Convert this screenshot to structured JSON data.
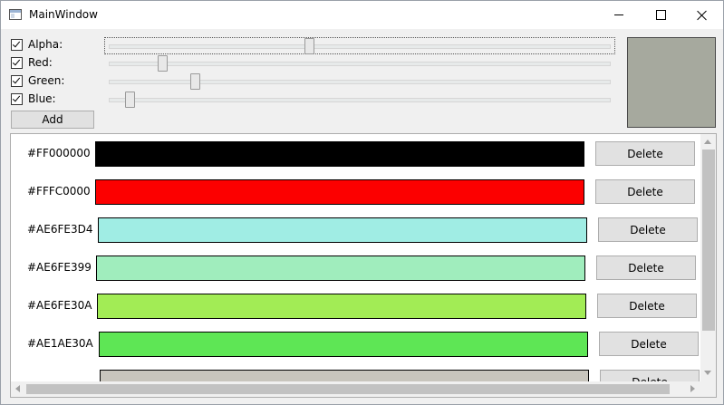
{
  "window": {
    "title": "MainWindow"
  },
  "controls": {
    "channels": [
      {
        "label": "Alpha:",
        "checked": true,
        "level": 0.4
      },
      {
        "label": "Red:",
        "checked": true,
        "level": 0.105
      },
      {
        "label": "Green:",
        "checked": true,
        "level": 0.17
      },
      {
        "label": "Blue:",
        "checked": true,
        "level": 0.04
      }
    ],
    "add_label": "Add",
    "preview_color": "#A6A99E"
  },
  "list": {
    "delete_label": "Delete",
    "items": [
      {
        "hex": "#FF000000",
        "color": "#000000"
      },
      {
        "hex": "#FFFC0000",
        "color": "#FC0000"
      },
      {
        "hex": "#AE6FE3D4",
        "color": "#A0EDE4"
      },
      {
        "hex": "#AE6FE399",
        "color": "#A0EDBD"
      },
      {
        "hex": "#AE6FE30A",
        "color": "#A2EC55"
      },
      {
        "hex": "#AE1AE30A",
        "color": "#5EE655"
      },
      {
        "hex": "",
        "color": "#C8C5BD"
      }
    ]
  }
}
